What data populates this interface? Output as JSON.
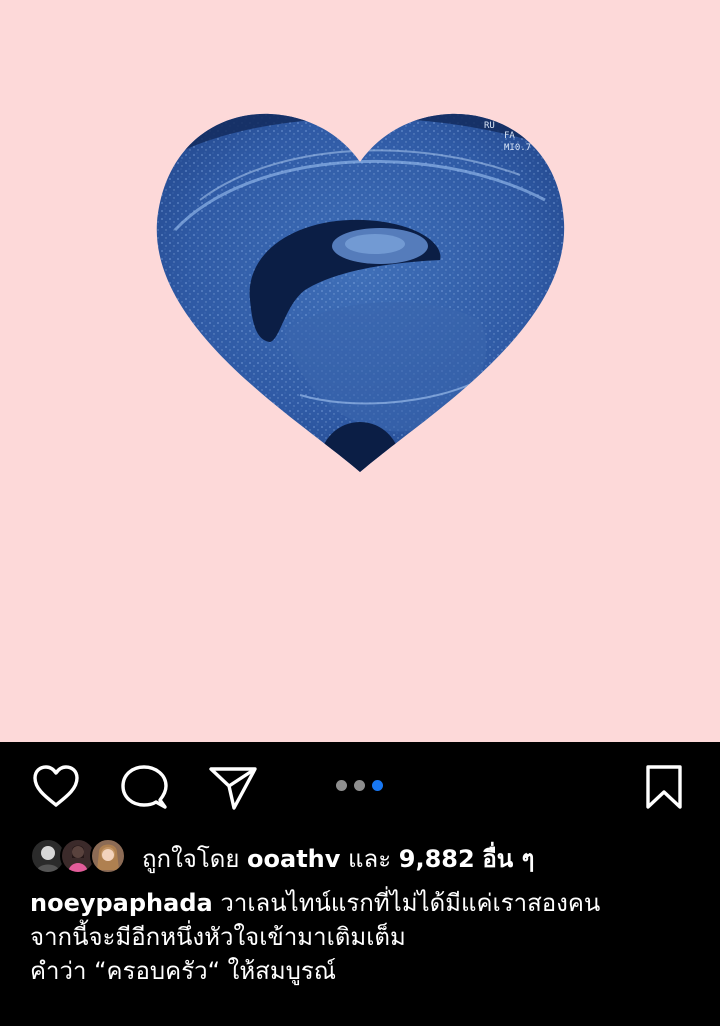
{
  "post": {
    "image_alt": "heart-shaped ultrasound image",
    "background_color": "#fdd9d9",
    "scan_labels": [
      "RU",
      "FA",
      "MI0.7"
    ]
  },
  "actions": {
    "like_icon": "heart-outline-icon",
    "comment_icon": "speech-bubble-icon",
    "share_icon": "paper-plane-icon",
    "save_icon": "bookmark-icon"
  },
  "carousel": {
    "total": 3,
    "active_index": 2,
    "active_color": "#1877f2",
    "inactive_color": "#8e8e8e"
  },
  "likes": {
    "prefix": "ถูกใจโดย",
    "user": "ooathv",
    "conjunction": "และ",
    "count": "9,882",
    "suffix": "อื่น ๆ"
  },
  "caption": {
    "username": "noeypaphada",
    "line1": "วาเลนไทน์แรกที่ไม่ได้มีแค่เราสองคน",
    "line2": "จากนี้จะมีอีกหนึ่งหัวใจเข้ามาเติมเต็ม",
    "line3": "คำว่า “ครอบครัว“ ให้สมบูรณ์"
  }
}
